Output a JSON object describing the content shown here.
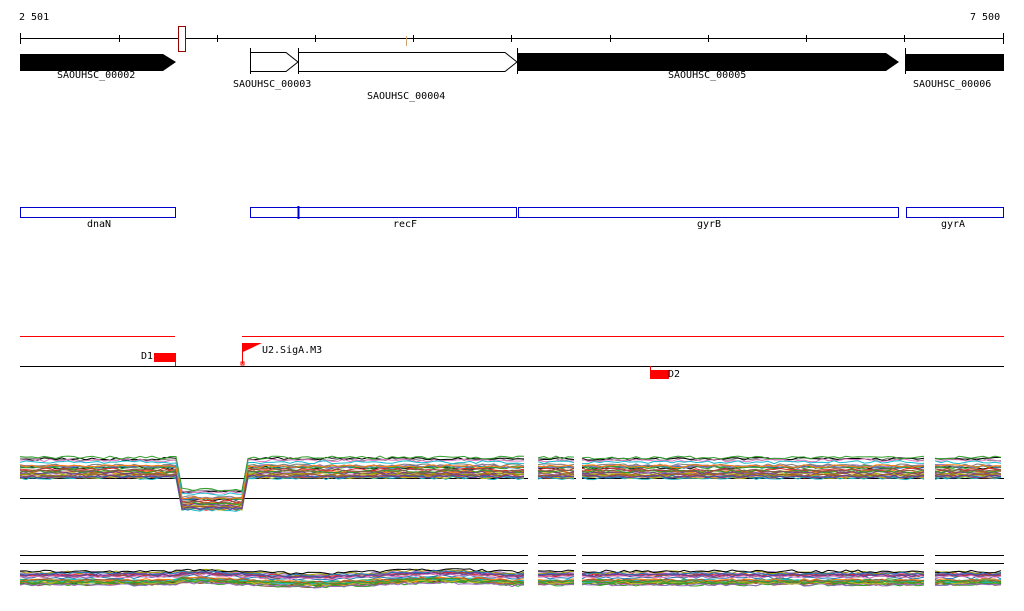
{
  "ruler": {
    "start_label": "2 501",
    "end_label": "7 500"
  },
  "genes": [
    {
      "id": "SAOUHSC_00002",
      "label": "SAOUHSC_00002",
      "fill": "#000000"
    },
    {
      "id": "SAOUHSC_00003",
      "label": "SAOUHSC_00003",
      "fill": "#ffffff"
    },
    {
      "id": "SAOUHSC_00004",
      "label": "SAOUHSC_00004",
      "fill": "#ffffff"
    },
    {
      "id": "SAOUHSC_00005",
      "label": "SAOUHSC_00005",
      "fill": "#000000"
    },
    {
      "id": "SAOUHSC_00006",
      "label": "SAOUHSC_00006",
      "fill": "#000000"
    }
  ],
  "gene_names": [
    {
      "label": "dnaN"
    },
    {
      "label": "recF"
    },
    {
      "label": "gyrB"
    },
    {
      "label": "gyrA"
    }
  ],
  "features": [
    {
      "label": "D1",
      "color": "#ff0000"
    },
    {
      "label": "U2.SigA.M3",
      "color": "#ff0000"
    },
    {
      "label": "D2",
      "color": "#ff0000"
    }
  ],
  "colors": {
    "gene_name_box": "#0000cc",
    "feature": "#ff0000",
    "highlight_box": "#990000"
  },
  "track_palette": [
    "#000000",
    "#d62728",
    "#2ca02c",
    "#9467bd",
    "#8c564b",
    "#e377c2",
    "#7f7f7f",
    "#bcbd22",
    "#17becf",
    "#1f77b4",
    "#ff7f0e",
    "#a05a2c",
    "#6a3d9a",
    "#33a02c",
    "#b15928",
    "#999900"
  ]
}
